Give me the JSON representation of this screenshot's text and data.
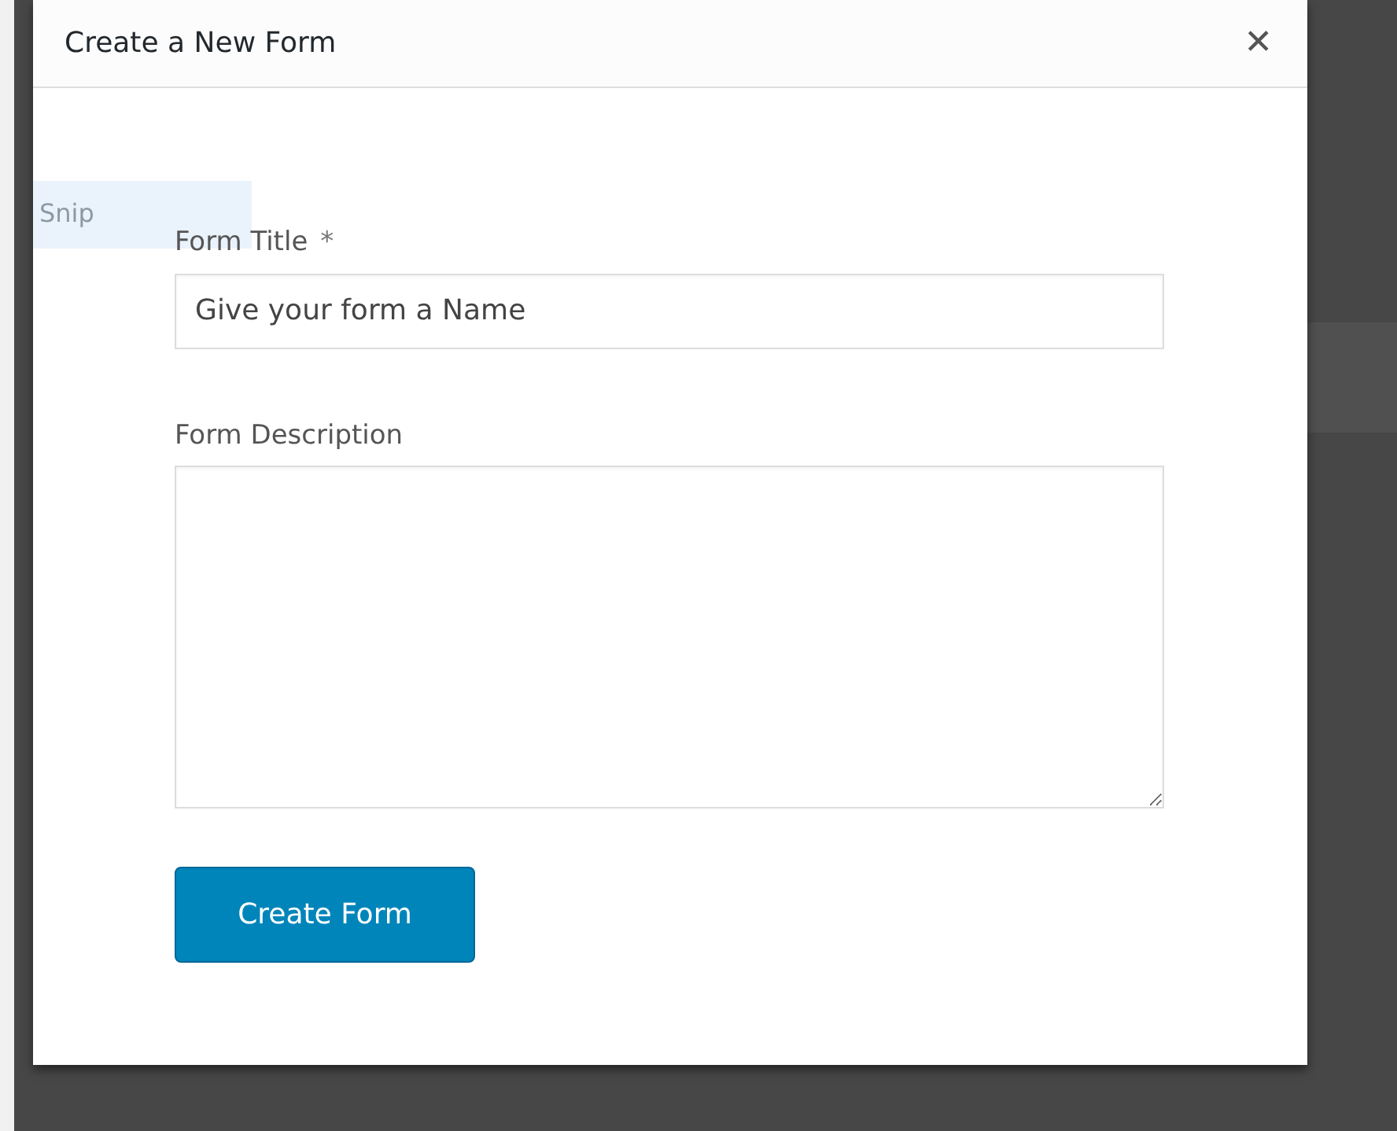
{
  "dialog": {
    "title": "Create a New Form",
    "close": "✕"
  },
  "ghost_label": "Snip",
  "fields": [
    {
      "kind": "input",
      "label": "Form Title",
      "required_mark": "*",
      "placeholder": "Give your form a Name"
    },
    {
      "kind": "textarea",
      "label": "Form Description"
    }
  ],
  "buttons": [
    "Create Form"
  ]
}
